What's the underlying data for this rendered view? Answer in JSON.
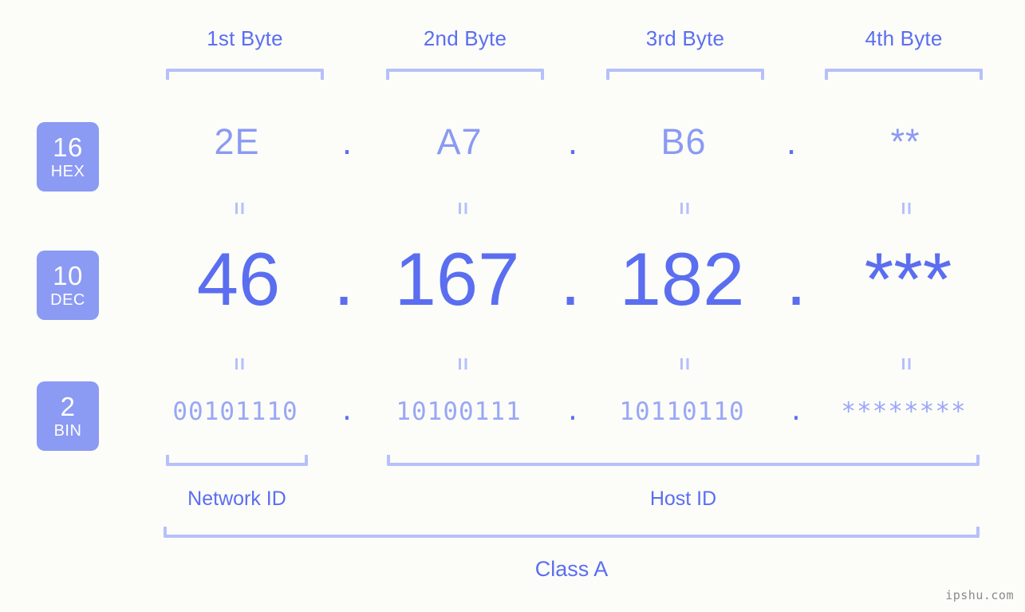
{
  "meta": {
    "watermark": "ipshu.com",
    "background_color": "#fcfdf9",
    "accent_color": "#5b6ef0",
    "accent_light_color": "#8b9af3",
    "bracket_color": "#b6c0fa",
    "separator": "."
  },
  "byte_headers": [
    {
      "label": "1st Byte"
    },
    {
      "label": "2nd Byte"
    },
    {
      "label": "3rd Byte"
    },
    {
      "label": "4th Byte"
    }
  ],
  "rows": [
    {
      "badge_number": "16",
      "badge_abbr": "HEX",
      "values": [
        "2E",
        "A7",
        "B6",
        "**"
      ]
    },
    {
      "badge_number": "10",
      "badge_abbr": "DEC",
      "values": [
        "46",
        "167",
        "182",
        "***"
      ]
    },
    {
      "badge_number": "2",
      "badge_abbr": "BIN",
      "values": [
        "00101110",
        "10100111",
        "10110110",
        "********"
      ]
    }
  ],
  "equals": {
    "glyph": "="
  },
  "segments": {
    "network_id": "Network ID",
    "host_id": "Host ID",
    "class": "Class A"
  },
  "chart_data": {
    "type": "table",
    "title": "IP address byte decomposition",
    "ip_address": "46.167.182.***",
    "address_class": "Class A",
    "columns": [
      "1st Byte",
      "2nd Byte",
      "3rd Byte",
      "4th Byte"
    ],
    "rows": [
      {
        "radix": 16,
        "name": "HEX",
        "values": [
          "2E",
          "A7",
          "B6",
          "**"
        ]
      },
      {
        "radix": 10,
        "name": "DEC",
        "values": [
          "46",
          "167",
          "182",
          "***"
        ]
      },
      {
        "radix": 2,
        "name": "BIN",
        "values": [
          "00101110",
          "10100111",
          "10110110",
          "********"
        ]
      }
    ],
    "network_id_bytes": [
      1
    ],
    "host_id_bytes": [
      2,
      3,
      4
    ]
  }
}
